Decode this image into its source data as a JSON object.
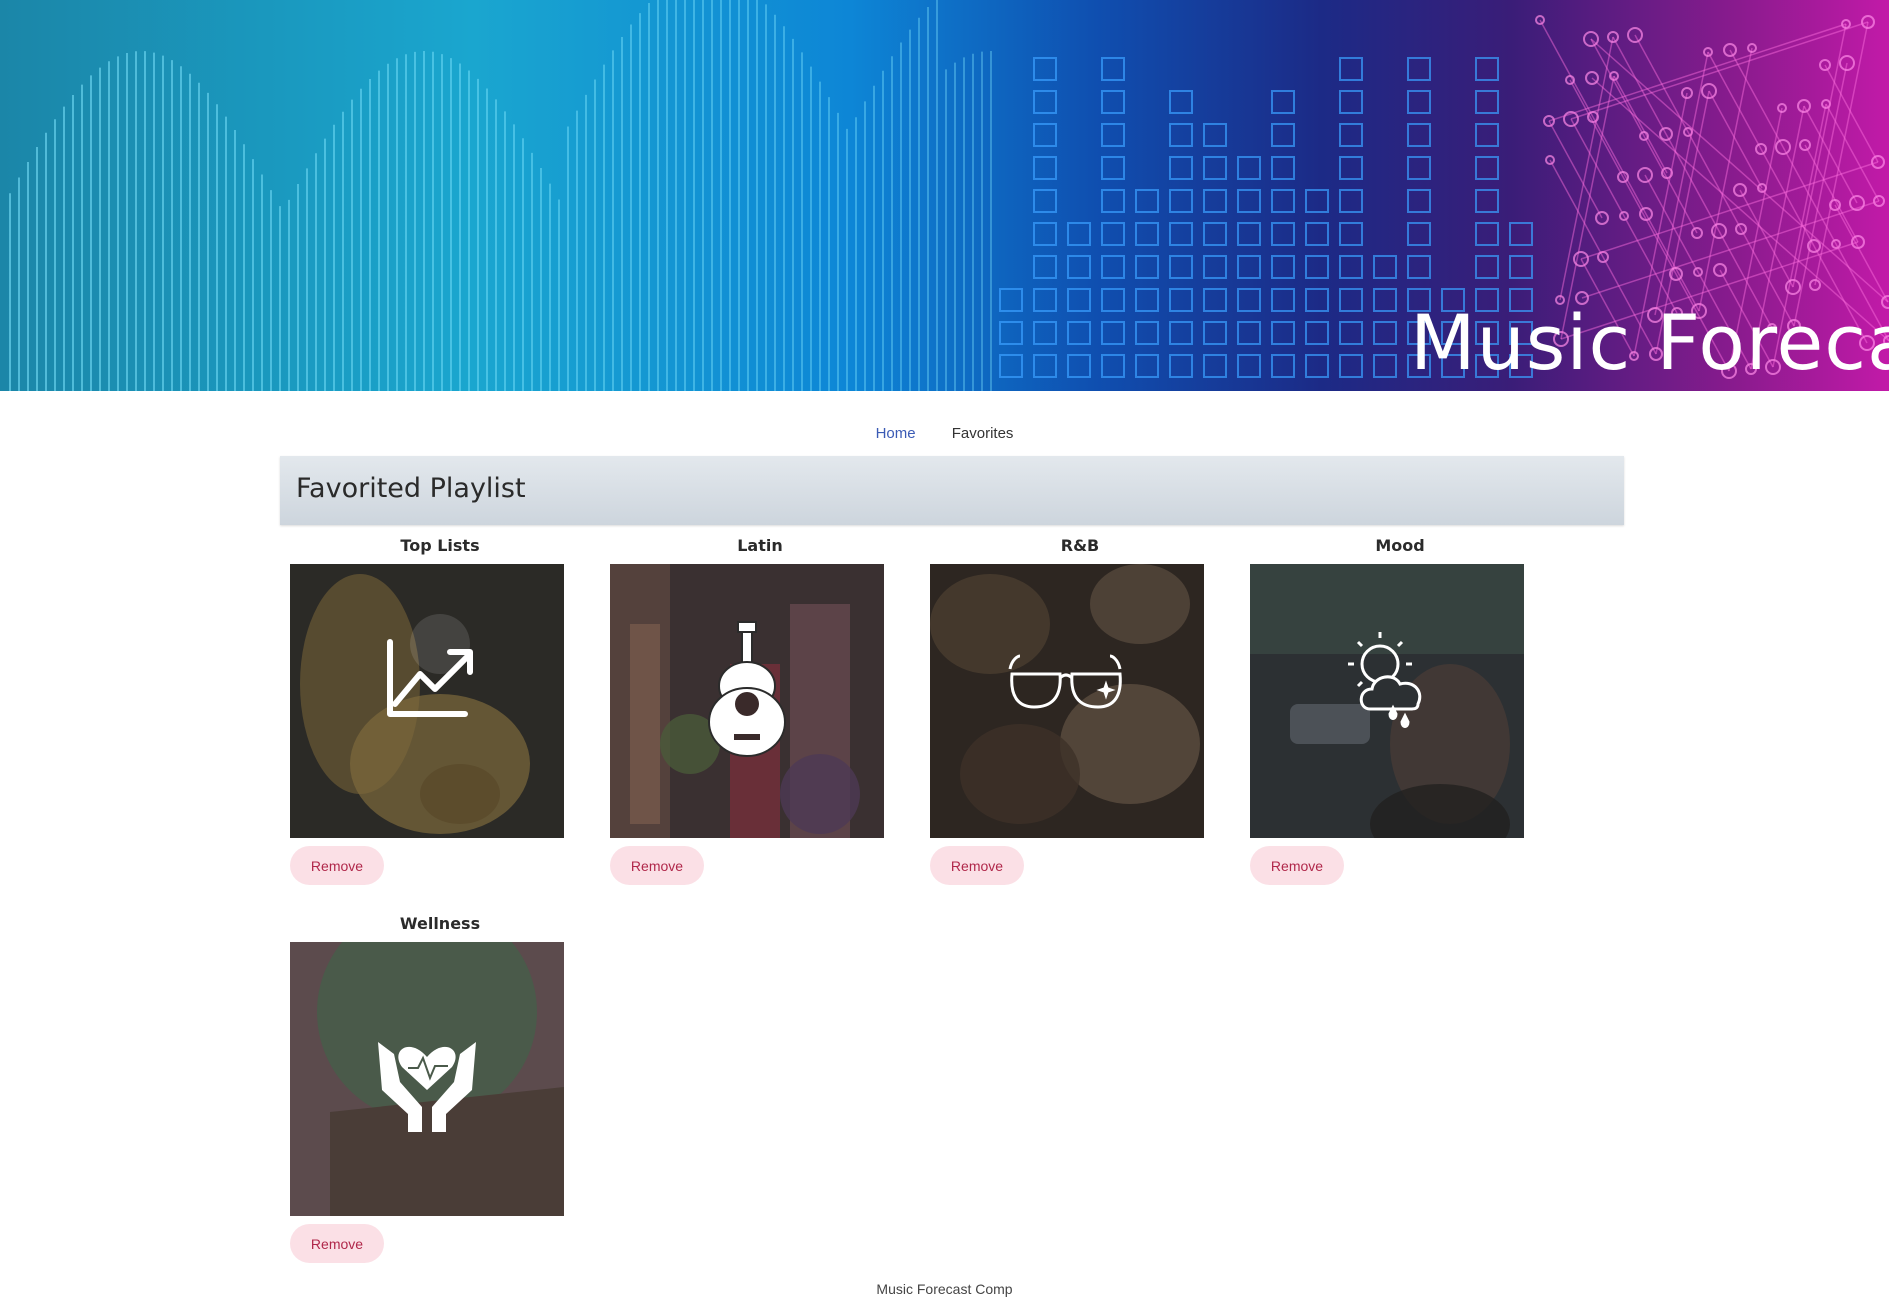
{
  "banner": {
    "title": "Music Forecast"
  },
  "nav": {
    "home": "Home",
    "favorites": "Favorites"
  },
  "section": {
    "title": "Favorited Playlist"
  },
  "playlists": [
    {
      "name": "Top Lists",
      "icon": "trending-up-icon",
      "remove_label": "Remove"
    },
    {
      "name": "Latin",
      "icon": "guitar-icon",
      "remove_label": "Remove"
    },
    {
      "name": "R&B",
      "icon": "sunglasses-icon",
      "remove_label": "Remove"
    },
    {
      "name": "Mood",
      "icon": "weather-icon",
      "remove_label": "Remove"
    },
    {
      "name": "Wellness",
      "icon": "heart-hands-icon",
      "remove_label": "Remove"
    }
  ],
  "footer": {
    "text": "Music Forecast Comp"
  },
  "colors": {
    "remove_bg": "#fbe0e6",
    "remove_text": "#b0274a",
    "nav_active": "#3b5bb5"
  }
}
